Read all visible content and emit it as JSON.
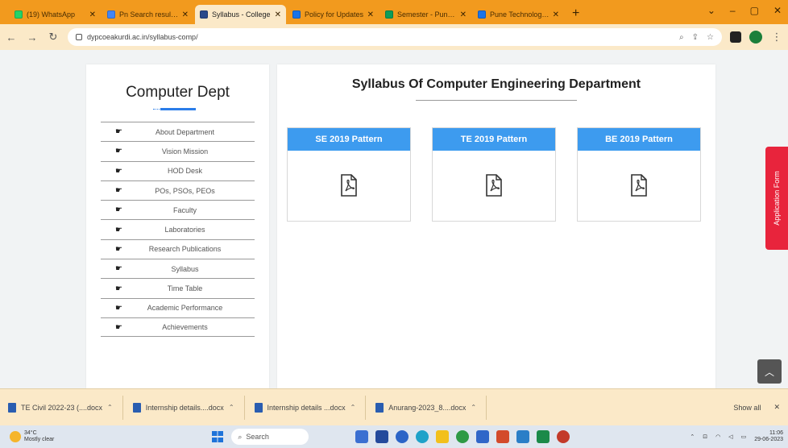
{
  "browser": {
    "tabs": [
      {
        "label": "(19) WhatsApp",
        "color": "#25d366",
        "active": false
      },
      {
        "label": "Pn Search results - p",
        "color": "#4285f4",
        "active": false
      },
      {
        "label": "Syllabus - College",
        "color": "#2b4a8a",
        "active": true
      },
      {
        "label": "Policy for Updates",
        "color": "#1a73e8",
        "active": false
      },
      {
        "label": "Semester - Pune Ne",
        "color": "#0f9d58",
        "active": false
      },
      {
        "label": "Pune Technologies",
        "color": "#1a73e8",
        "active": false
      }
    ],
    "new_tab": "+",
    "url": "dypcoeakurdi.ac.in/syllabus-comp/"
  },
  "sidebar": {
    "title": "Computer Dept",
    "items": [
      {
        "label": "About Department"
      },
      {
        "label": "Vision Mission"
      },
      {
        "label": "HOD Desk"
      },
      {
        "label": "POs, PSOs, PEOs"
      },
      {
        "label": "Faculty"
      },
      {
        "label": "Laboratories"
      },
      {
        "label": "Research Publications"
      },
      {
        "label": "Syllabus"
      },
      {
        "label": "Time Table"
      },
      {
        "label": "Academic Performance"
      },
      {
        "label": "Achievements"
      }
    ]
  },
  "main": {
    "title": "Syllabus Of Computer Engineering Department",
    "cards": [
      {
        "label": "SE 2019 Pattern"
      },
      {
        "label": "TE 2019 Pattern"
      },
      {
        "label": "BE 2019 Pattern"
      }
    ]
  },
  "application_form": "Application Form",
  "downloads": {
    "items": [
      {
        "label": "TE Civil 2022-23 (....docx"
      },
      {
        "label": "Internship details....docx"
      },
      {
        "label": "Internship details ...docx"
      },
      {
        "label": "Anurang-2023_8....docx"
      }
    ],
    "show_all": "Show all"
  },
  "taskbar": {
    "weather_temp": "34°C",
    "weather_desc": "Mostly clear",
    "search_placeholder": "Search",
    "time": "11:06",
    "date": "29-06-2023"
  },
  "colors": {
    "tab_strip": "#f29a1e",
    "card_header": "#3d9bef",
    "application_form": "#e8243c",
    "underline": "#2b7de9"
  }
}
